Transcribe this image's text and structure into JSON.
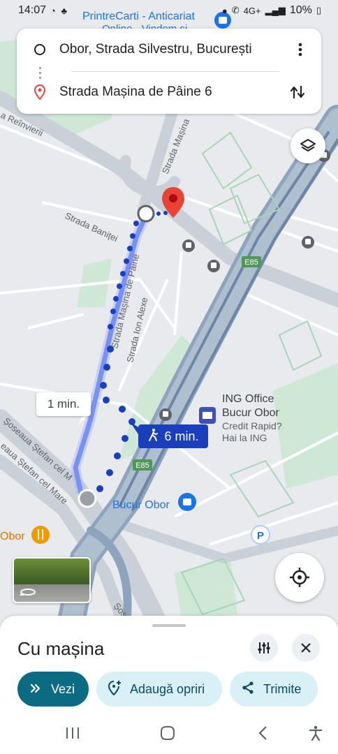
{
  "status_bar": {
    "time": "14:07",
    "battery": "10%",
    "network": "4G+"
  },
  "route": {
    "origin": "Obor, Strada Silvestru, București",
    "destination": "Strada Mașina de Pâine 6"
  },
  "map": {
    "street_labels": {
      "reinvierii": "a Reînvierii",
      "masina_north": "Strada Mașina",
      "banitei": "Strada Baniței",
      "masina_de_paine": "Strada Mașina de Pâine",
      "ion_alexe": "Strada Ion Alexe",
      "stefan_1": "Șoseaua Ștefan cel M",
      "stefan_2": "eaua Ștefan cel Mare",
      "sose_bottom": "Șos"
    },
    "poi": {
      "top_shop": "PrintreCarti - Anticariat",
      "top_shop_sub": "Online - Vindem si",
      "ing_line1": "ING Office",
      "ing_line2": "Bucur Obor",
      "ing_sub1": "Credit Rapid?",
      "ing_sub2": "Hai la ING",
      "bucur_obor": "Bucur Obor",
      "obor": "Obor",
      "parking": "P"
    },
    "road_badges": [
      "E85",
      "E85"
    ],
    "callouts": {
      "car_time": "1 min.",
      "walk_time": "6 min."
    }
  },
  "sheet": {
    "title": "Cu mașina",
    "buttons": {
      "go": "Vezi",
      "add_stops": "Adaugă opriri",
      "share": "Trimite"
    }
  },
  "icons": {
    "kebab": "more-vert-icon",
    "swap": "swap-vertical-icon",
    "layers": "layers-icon",
    "my_location": "my-location-icon",
    "filter": "tune-icon",
    "close": "close-icon"
  },
  "colors": {
    "route_blue": "#4c6ef5",
    "walk_dots": "#1a3fbd",
    "pin_red": "#ea4335",
    "primary_chip": "#0b6b82",
    "secondary_chip": "#d9f0f7"
  }
}
